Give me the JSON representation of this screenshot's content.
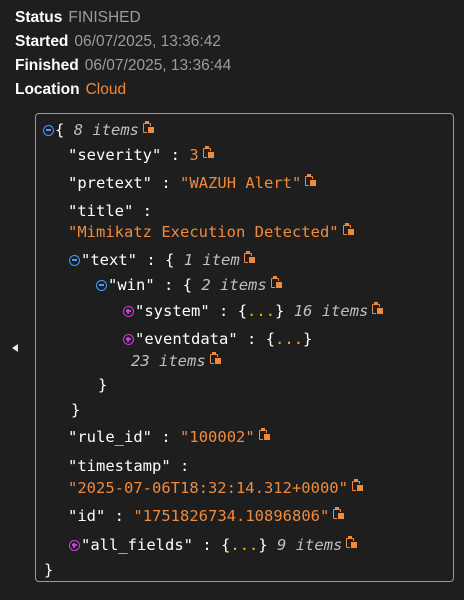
{
  "meta": {
    "status_label": "Status",
    "status_value": "FINISHED",
    "started_label": "Started",
    "started_value": "06/07/2025, 13:36:42",
    "finished_label": "Finished",
    "finished_value": "06/07/2025, 13:36:44",
    "location_label": "Location",
    "location_value": "Cloud"
  },
  "json": {
    "root_open": "{",
    "root_count": "8 items",
    "severity_key": "\"severity\"",
    "severity_value": "3",
    "pretext_key": "\"pretext\"",
    "pretext_value": "\"WAZUH Alert\"",
    "title_key": "\"title\"",
    "title_value": "\"Mimikatz Execution Detected\"",
    "text_key": "\"text\"",
    "text_count": "1 item",
    "win_key": "\"win\"",
    "win_count": "2 items",
    "system_key": "\"system\"",
    "system_collapsed": "...",
    "system_count": "16 items",
    "eventdata_key": "\"eventdata\"",
    "eventdata_collapsed": "...",
    "eventdata_count": "23 items",
    "rule_id_key": "\"rule_id\"",
    "rule_id_value": "\"100002\"",
    "timestamp_key": "\"timestamp\"",
    "timestamp_value": "\"2025-07-06T18:32:14.312+0000\"",
    "id_key": "\"id\"",
    "id_value": "\"1751826734.10896806\"",
    "all_fields_key": "\"all_fields\"",
    "all_fields_collapsed": "...",
    "all_fields_count": "9 items",
    "open_brace": "{",
    "close_brace": "}",
    "colon": ":"
  },
  "colors": {
    "background": "#1e1e1e",
    "string_value": "#f08a3c",
    "muted_text": "#9c9c9c",
    "collapse_toggle": "#4a9cff",
    "expand_toggle": "#cc3fd8",
    "ellipsis": "#f5b400"
  },
  "icons": {
    "copy": "copy-icon",
    "expand": "expand-icon",
    "collapse": "collapse-icon",
    "panel_toggle": "caret-left-icon"
  }
}
